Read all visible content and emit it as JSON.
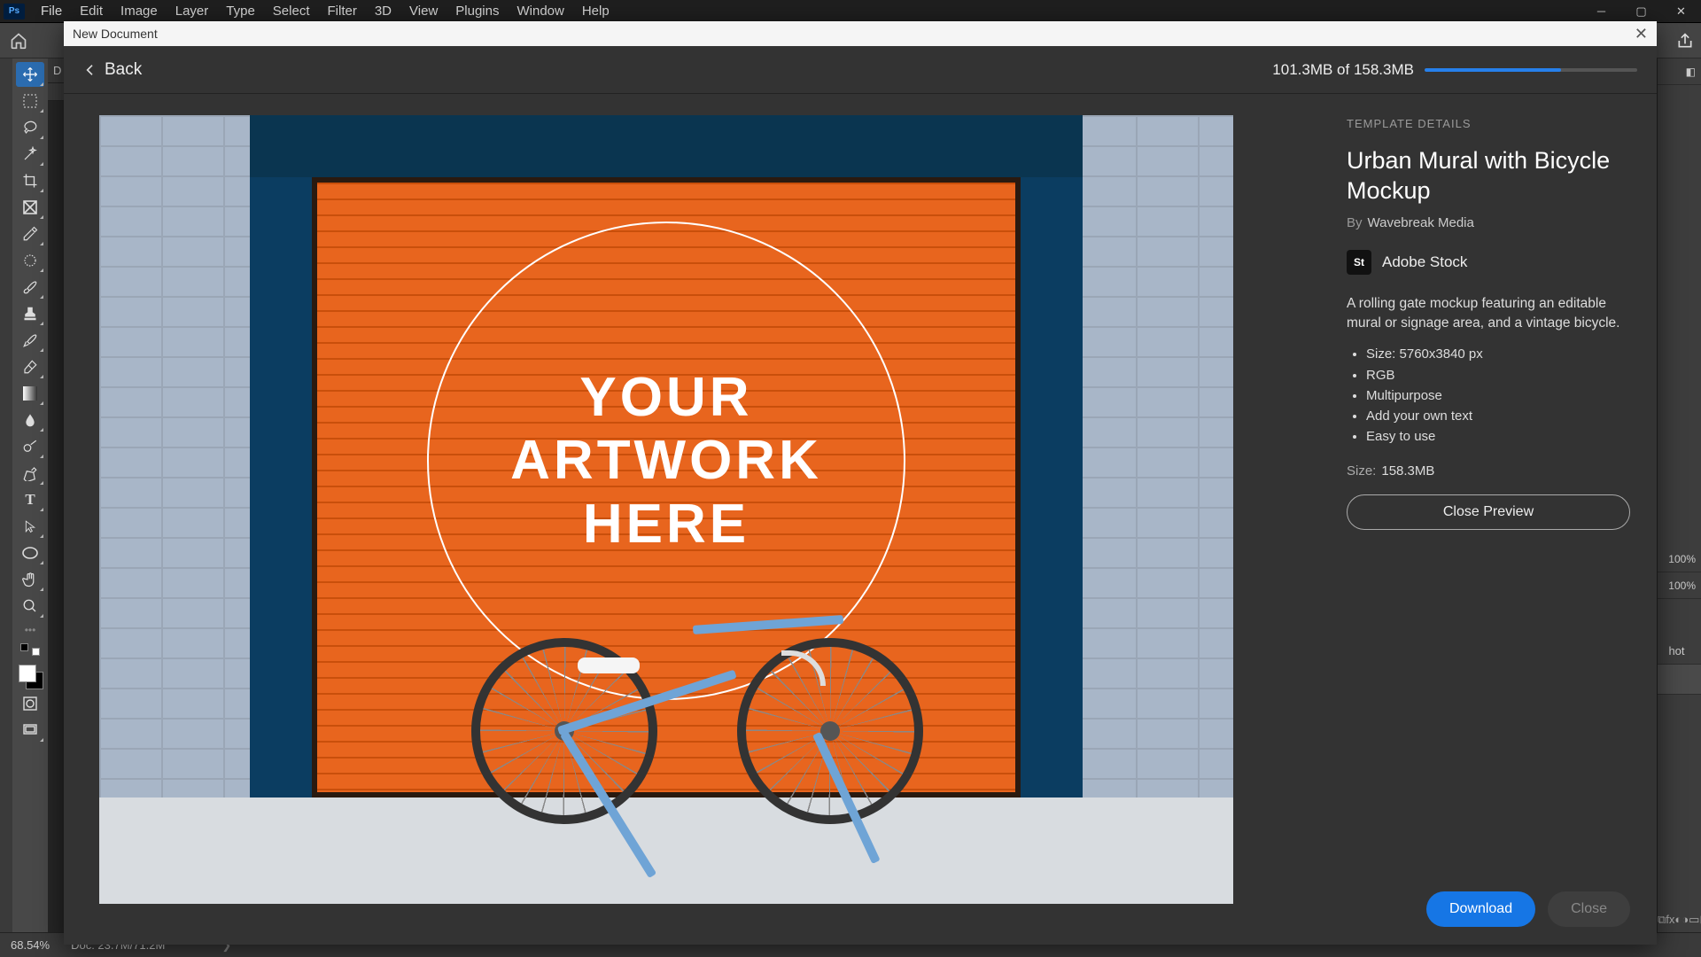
{
  "menubar": [
    "File",
    "Edit",
    "Image",
    "Layer",
    "Type",
    "Select",
    "Filter",
    "3D",
    "View",
    "Plugins",
    "Window",
    "Help"
  ],
  "tab": {
    "letter": "D"
  },
  "statusbar": {
    "zoom": "68.54%",
    "doc": "Doc: 23.7M/71.2M"
  },
  "modal": {
    "title": "New Document",
    "back": "Back",
    "progress": {
      "text": "101.3MB of 158.3MB",
      "percent": 64
    }
  },
  "preview_artwork": {
    "l1": "YOUR",
    "l2": "ARTWORK",
    "l3": "HERE"
  },
  "details": {
    "label": "TEMPLATE DETAILS",
    "title": "Urban Mural with Bicycle Mockup",
    "by_label": "By",
    "author": "Wavebreak Media",
    "stock_badge": "St",
    "stock_name": "Adobe Stock",
    "description": "A rolling gate mockup featuring an editable mural or signage area, and a vintage bicycle.",
    "bullets": [
      "Size: 5760x3840 px",
      "RGB",
      "Multipurpose",
      "Add your own text",
      "Easy to use"
    ],
    "size_label": "Size:",
    "size_value": "158.3MB",
    "close_preview": "Close Preview",
    "download": "Download",
    "close": "Close"
  },
  "peek": {
    "hundred": "100%",
    "hot": "hot"
  }
}
